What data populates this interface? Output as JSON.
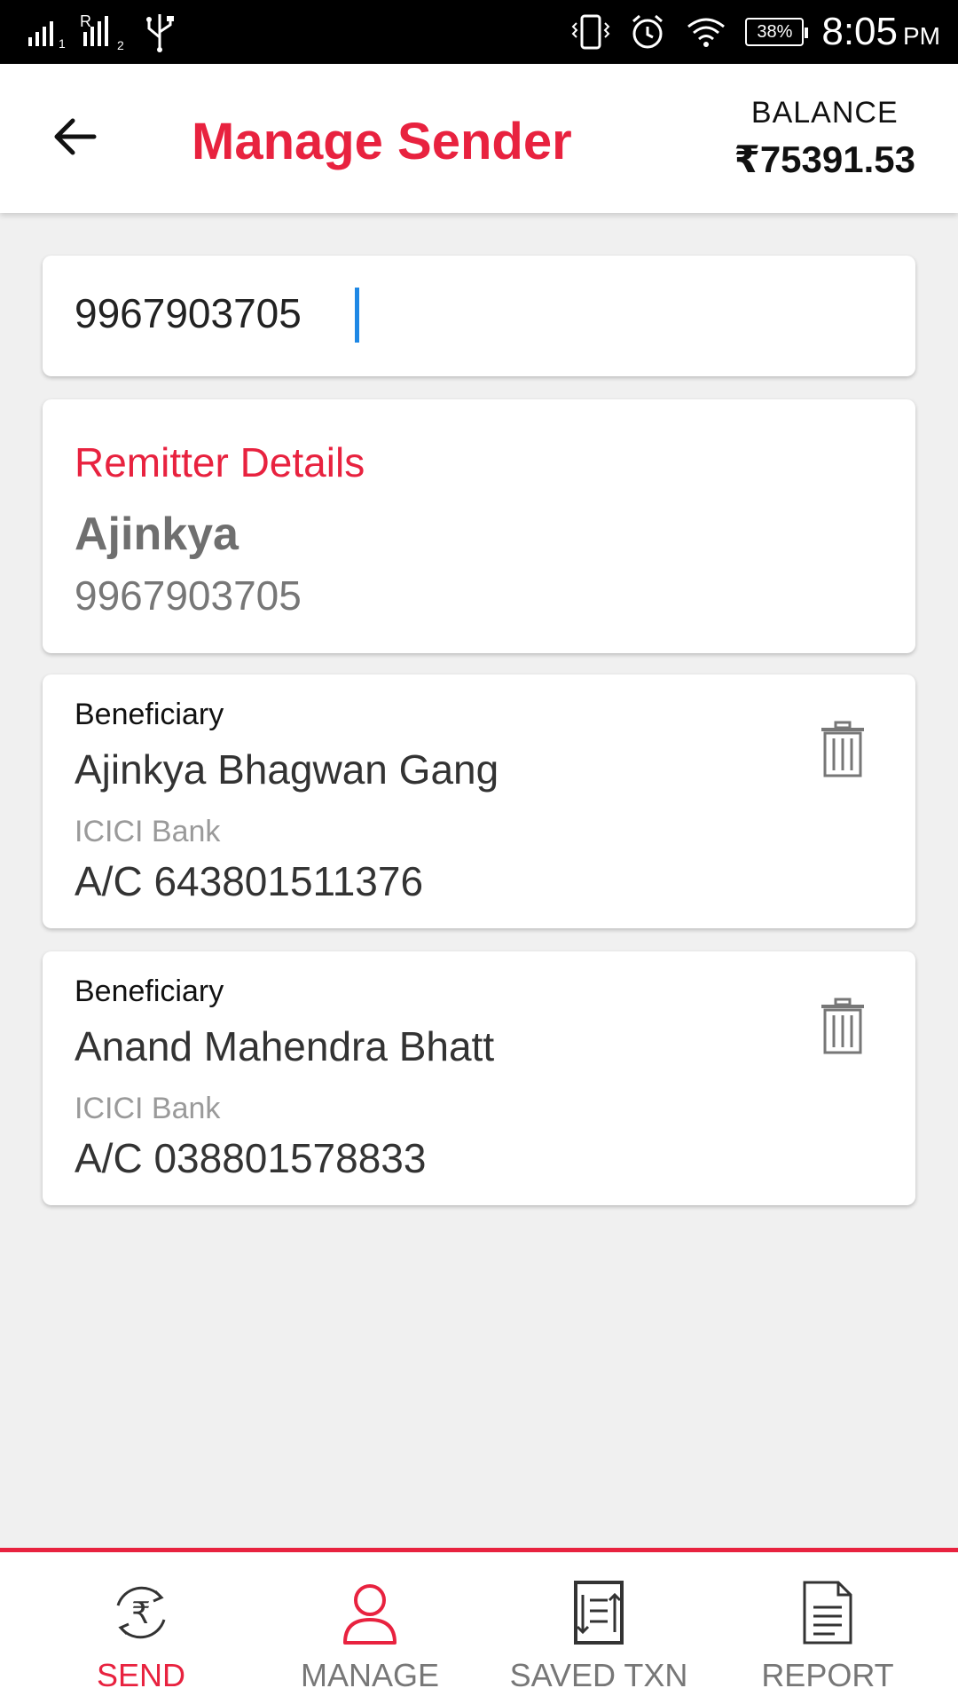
{
  "status_bar": {
    "time": "8:05",
    "ampm": "PM",
    "battery": "38%",
    "icons": [
      "signal-1-icon",
      "signal-2-roaming-icon",
      "usb-icon",
      "vibrate-icon",
      "alarm-icon",
      "wifi-icon",
      "battery-icon"
    ]
  },
  "header": {
    "title": "Manage Sender",
    "balance_label": "BALANCE",
    "balance_value": "₹75391.53"
  },
  "search": {
    "value": "9967903705"
  },
  "remitter": {
    "heading": "Remitter Details",
    "name": "Ajinkya",
    "mobile": "9967903705"
  },
  "beneficiaries": [
    {
      "label": "Beneficiary",
      "name": "Ajinkya Bhagwan Gang",
      "bank": "ICICI Bank",
      "account": "A/C 643801511376"
    },
    {
      "label": "Beneficiary",
      "name": "Anand Mahendra Bhatt",
      "bank": "ICICI Bank",
      "account": "A/C 038801578833"
    }
  ],
  "bottom_nav": [
    {
      "label": "SEND",
      "icon": "rupee-exchange-icon",
      "active": true
    },
    {
      "label": "MANAGE",
      "icon": "user-icon",
      "active": false
    },
    {
      "label": "SAVED TXN",
      "icon": "saved-txn-icon",
      "active": false
    },
    {
      "label": "REPORT",
      "icon": "report-icon",
      "active": false
    }
  ],
  "colors": {
    "accent": "#e8223f",
    "background": "#f0f0f0",
    "caret": "#1e88e5"
  }
}
